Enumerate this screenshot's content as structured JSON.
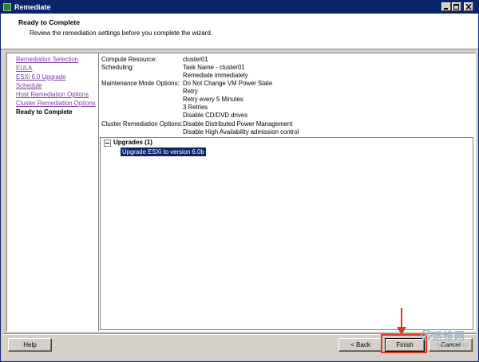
{
  "window": {
    "title": "Remediate"
  },
  "header": {
    "title": "Ready to Complete",
    "description": "Review the remediation settings before you complete the wizard."
  },
  "nav": {
    "items": [
      {
        "label": "Remediation Selection"
      },
      {
        "label": "EULA"
      },
      {
        "label": "ESXi 6.0 Upgrade"
      },
      {
        "label": "Schedule"
      },
      {
        "label": "Host Remediation Options"
      },
      {
        "label": "Cluster Remediation Options"
      },
      {
        "label": "Ready to Complete"
      }
    ]
  },
  "summary": {
    "compute_label": "Compute Resource:",
    "compute_value": "cluster01",
    "scheduling_label": "Scheduling:",
    "scheduling_values": [
      "Task Name - cluster01",
      "Remediate immediately"
    ],
    "maintenance_label": "Maintenance Mode Options:",
    "maintenance_values": [
      "Do Not Change VM Power State",
      "Retry",
      "Retry every 5 Minutes",
      "3 Retries",
      "Disable CD/DVD drives"
    ],
    "cluster_label": "Cluster Remediation Options:",
    "cluster_values": [
      "Disable Distributed Power Management",
      "Disable High Availability admission control"
    ]
  },
  "tree": {
    "heading": "Upgrades (1)",
    "item": "Upgrade ESXi to version 6.0b"
  },
  "buttons": {
    "help": "Help",
    "back": "< Back",
    "finish": "Finish",
    "cancel": "Cancel"
  },
  "watermark": {
    "logo_text": "运维网",
    "sub_text": "iyunv.com"
  },
  "colors": {
    "title_bar": "#0a246a",
    "link": "#7b3fa0",
    "selection": "#0a246a",
    "highlight": "#d43a2a"
  }
}
